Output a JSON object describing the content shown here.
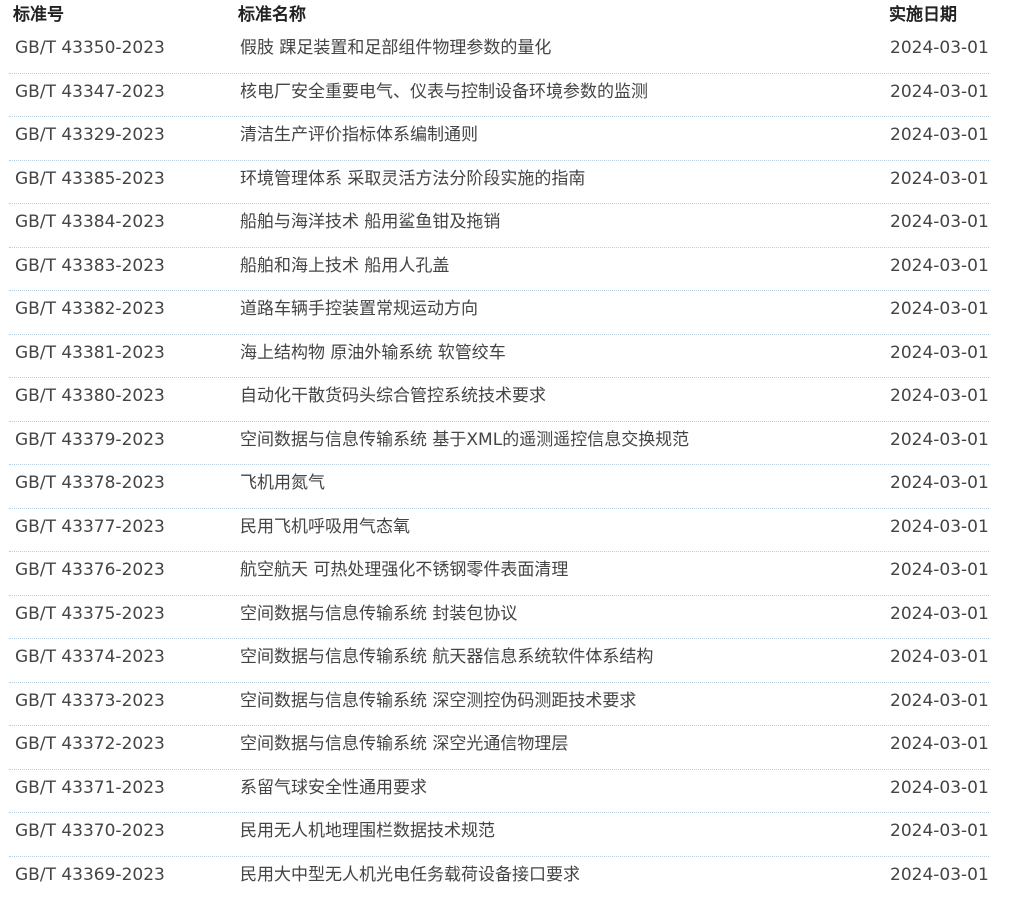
{
  "header": {
    "code": "标准号",
    "name": "标准名称",
    "date": "实施日期"
  },
  "rows": [
    {
      "code": "GB/T 43350-2023",
      "name": "假肢 踝足装置和足部组件物理参数的量化",
      "date": "2024-03-01"
    },
    {
      "code": "GB/T 43347-2023",
      "name": "核电厂安全重要电气、仪表与控制设备环境参数的监测",
      "date": "2024-03-01"
    },
    {
      "code": "GB/T 43329-2023",
      "name": "清洁生产评价指标体系编制通则",
      "date": "2024-03-01"
    },
    {
      "code": "GB/T 43385-2023",
      "name": "环境管理体系 采取灵活方法分阶段实施的指南",
      "date": "2024-03-01"
    },
    {
      "code": "GB/T 43384-2023",
      "name": "船舶与海洋技术 船用鲨鱼钳及拖销",
      "date": "2024-03-01"
    },
    {
      "code": "GB/T 43383-2023",
      "name": "船舶和海上技术 船用人孔盖",
      "date": "2024-03-01"
    },
    {
      "code": "GB/T 43382-2023",
      "name": "道路车辆手控装置常规运动方向",
      "date": "2024-03-01"
    },
    {
      "code": "GB/T 43381-2023",
      "name": "海上结构物 原油外输系统 软管绞车",
      "date": "2024-03-01"
    },
    {
      "code": "GB/T 43380-2023",
      "name": "自动化干散货码头综合管控系统技术要求",
      "date": "2024-03-01"
    },
    {
      "code": "GB/T 43379-2023",
      "name": "空间数据与信息传输系统 基于XML的遥测遥控信息交换规范",
      "date": "2024-03-01"
    },
    {
      "code": "GB/T 43378-2023",
      "name": "飞机用氮气",
      "date": "2024-03-01"
    },
    {
      "code": "GB/T 43377-2023",
      "name": "民用飞机呼吸用气态氧",
      "date": "2024-03-01"
    },
    {
      "code": "GB/T 43376-2023",
      "name": "航空航天 可热处理强化不锈钢零件表面清理",
      "date": "2024-03-01"
    },
    {
      "code": "GB/T 43375-2023",
      "name": "空间数据与信息传输系统 封装包协议",
      "date": "2024-03-01"
    },
    {
      "code": "GB/T 43374-2023",
      "name": "空间数据与信息传输系统 航天器信息系统软件体系结构",
      "date": "2024-03-01"
    },
    {
      "code": "GB/T 43373-2023",
      "name": "空间数据与信息传输系统 深空测控伪码测距技术要求",
      "date": "2024-03-01"
    },
    {
      "code": "GB/T 43372-2023",
      "name": "空间数据与信息传输系统 深空光通信物理层",
      "date": "2024-03-01"
    },
    {
      "code": "GB/T 43371-2023",
      "name": "系留气球安全性通用要求",
      "date": "2024-03-01"
    },
    {
      "code": "GB/T 43370-2023",
      "name": "民用无人机地理围栏数据技术规范",
      "date": "2024-03-01"
    },
    {
      "code": "GB/T 43369-2023",
      "name": "民用大中型无人机光电任务载荷设备接口要求",
      "date": "2024-03-01"
    }
  ]
}
